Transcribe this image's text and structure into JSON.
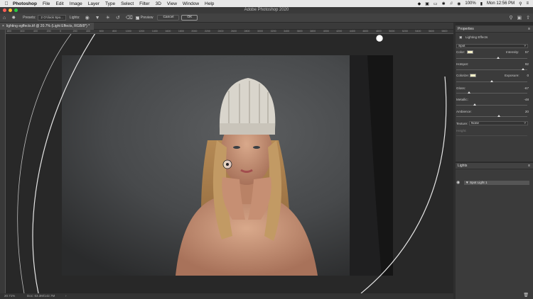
{
  "menubar": {
    "app_name": "Photoshop",
    "items": [
      "File",
      "Edit",
      "Image",
      "Layer",
      "Type",
      "Select",
      "Filter",
      "3D",
      "View",
      "Window",
      "Help"
    ],
    "battery": "100%",
    "datetime": "Mon 12:56 PM"
  },
  "window": {
    "title": "Adobe Photoshop 2020"
  },
  "options": {
    "presets_label": "Presets:",
    "presets_value": "2 O'clock Spo...",
    "lights_label": "Lights:",
    "preview_label": "Preview",
    "cancel_label": "Cancel",
    "ok_label": "OK"
  },
  "document": {
    "tab_title": "lighting egffects.tif @ 20.7% (Light Effects, RGB/8*) *",
    "ruler_ticks": [
      "800",
      "600",
      "400",
      "200",
      "0",
      "200",
      "400",
      "600",
      "800",
      "1000",
      "1200",
      "1400",
      "1600",
      "1800",
      "2000",
      "2200",
      "2400",
      "2600",
      "2800",
      "3000",
      "3200",
      "3400",
      "3600",
      "3800",
      "4000",
      "4200",
      "4400",
      "4600",
      "4800",
      "5000",
      "5200",
      "5400",
      "5600",
      "5800"
    ]
  },
  "status": {
    "zoom": "20.71%",
    "doc_size": "Doc: 63.3M/142.7M"
  },
  "properties": {
    "panel_title": "Properties",
    "subtitle": "Lighting Effects",
    "light_type": "Spot",
    "color_label": "Color:",
    "intensity_label": "Intensity:",
    "intensity_value": "57",
    "hotspot_label": "Hotspot:",
    "hotspot_value": "92",
    "colorize_label": "Colorize:",
    "exposure_label": "Exposure:",
    "exposure_value": "0",
    "gloss_label": "Gloss:",
    "gloss_value": "-67",
    "metallic_label": "Metallic:",
    "metallic_value": "-48",
    "ambience_label": "Ambience:",
    "ambience_value": "20",
    "texture_label": "Texture:",
    "texture_value": "None",
    "height_label": "Height:",
    "light_color": "#f6f0c8",
    "colorize_color": "#f6f2c6"
  },
  "lights_panel": {
    "title": "Lights",
    "items": [
      {
        "label": "Spot Light 1"
      }
    ]
  }
}
